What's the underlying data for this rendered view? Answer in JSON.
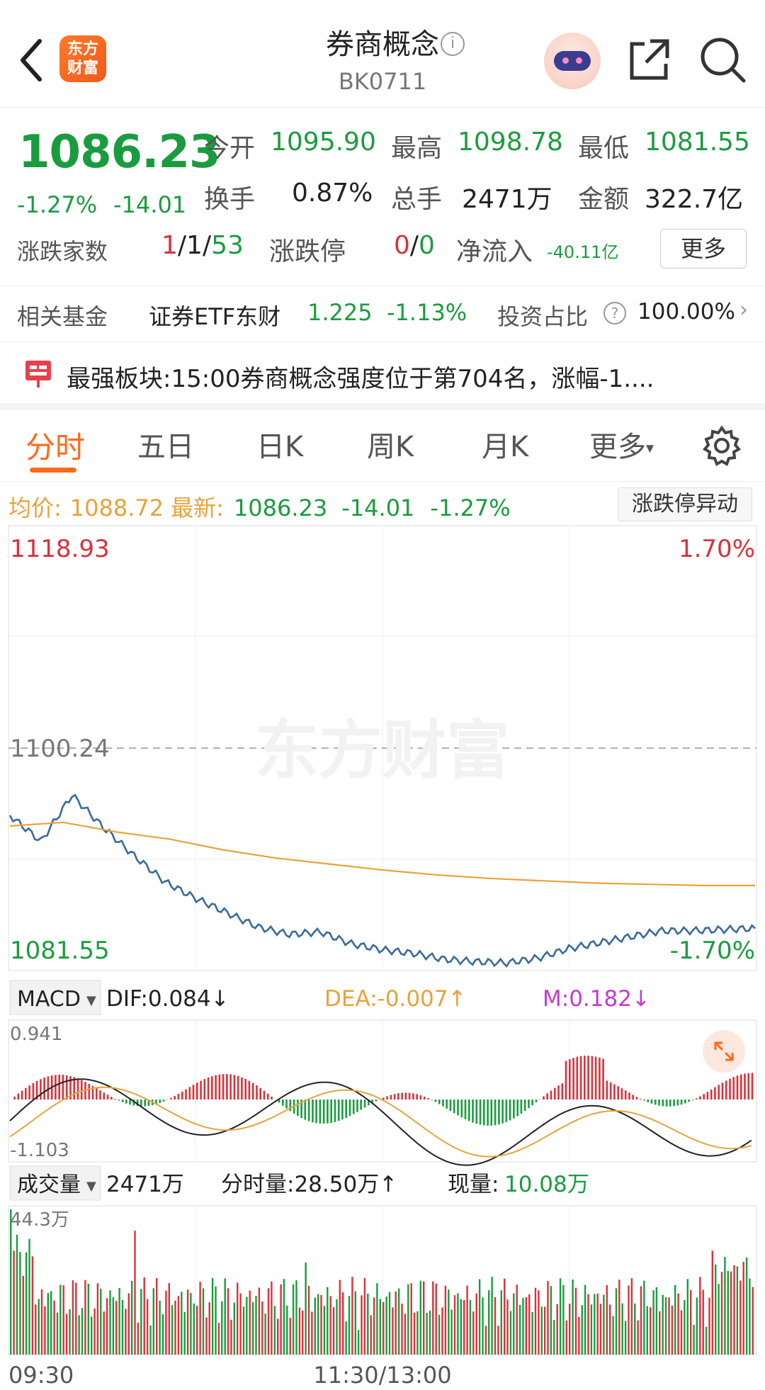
{
  "header": {
    "title": "券商概念",
    "code": "BK0711",
    "logo_text": "东方财富"
  },
  "quote": {
    "price": "1086.23",
    "change_pct": "-1.27%",
    "change_amt": "-14.01",
    "open_label": "今开",
    "open": "1095.90",
    "high_label": "最高",
    "high": "1098.78",
    "low_label": "最低",
    "low": "1081.55",
    "turnover_label": "换手",
    "turnover": "0.87%",
    "volume_label": "总手",
    "volume": "2471万",
    "amount_label": "金额",
    "amount": "322.7亿",
    "advdec_label": "涨跌家数",
    "adv": "1",
    "flat": "/1/",
    "dec": "53",
    "limit_label": "涨跌停",
    "limit_up": "0",
    "limit_sep": "/",
    "limit_down": "0",
    "netflow_label": "净流入",
    "netflow": "-40.11亿",
    "more_button": "更多"
  },
  "fund": {
    "label": "相关基金",
    "name": "证券ETF东财",
    "price": "1.225",
    "change": "-1.13%",
    "ratio_label": "投资占比",
    "ratio": "100.00%"
  },
  "strongest": {
    "label": "最强板块:",
    "text": "15:00券商概念强度位于第704名，涨幅-1...."
  },
  "tabs": [
    "分时",
    "五日",
    "日K",
    "周K",
    "月K",
    "更多"
  ],
  "summary": {
    "avg_label": "均价:",
    "avg": "1088.72",
    "latest_label": "最新:",
    "latest": "1086.23",
    "chg": "-14.01",
    "pct": "-1.27%",
    "limit_button": "涨跌停异动"
  },
  "price_chart": {
    "top_price": "1118.93",
    "top_pct": "1.70%",
    "mid_price": "1100.24",
    "bottom_price": "1081.55",
    "bottom_pct": "-1.70%",
    "watermark": "东方财富"
  },
  "macd": {
    "selector": "MACD",
    "dif": "DIF:0.084↓",
    "dea": "DEA:-0.007↑",
    "m": "M:0.182↓",
    "top": "0.941",
    "bottom": "-1.103"
  },
  "volume_chart": {
    "selector": "成交量",
    "total": "2471万",
    "minute": "分时量:28.50万↑",
    "current_label": "现量:",
    "current": "10.08万",
    "top": "44.3万"
  },
  "time_axis": {
    "start": "09:30",
    "mid": "11:30/13:00"
  },
  "colors": {
    "up": "#d9323a",
    "down": "#1a9c3e",
    "price_line": "#3a6a9a",
    "avg_line": "#e8a33a",
    "accent": "#ff6a1a",
    "magenta": "#c43ad0"
  },
  "chart_data": {
    "type": "line",
    "ylim": [
      1081.55,
      1118.93
    ],
    "base": 1100.24,
    "series": [
      {
        "name": "分时",
        "values": [
          1094.6,
          1092.4,
          1096.3,
          1093.6,
          1091.2,
          1089.0,
          1087.6,
          1086.4,
          1085.2,
          1084.6,
          1084.8,
          1083.8,
          1083.3,
          1083.0,
          1082.5,
          1082.3,
          1082.2,
          1082.6,
          1083.4,
          1083.9,
          1084.4,
          1084.9,
          1084.9,
          1085.0,
          1085.1
        ]
      },
      {
        "name": "均价",
        "values": [
          1093.7,
          1094.0,
          1093.2,
          1092.6,
          1091.7,
          1091.0,
          1090.5,
          1090.0,
          1089.6,
          1089.3,
          1089.1,
          1088.9,
          1088.8,
          1088.7,
          1088.7
        ]
      }
    ]
  }
}
